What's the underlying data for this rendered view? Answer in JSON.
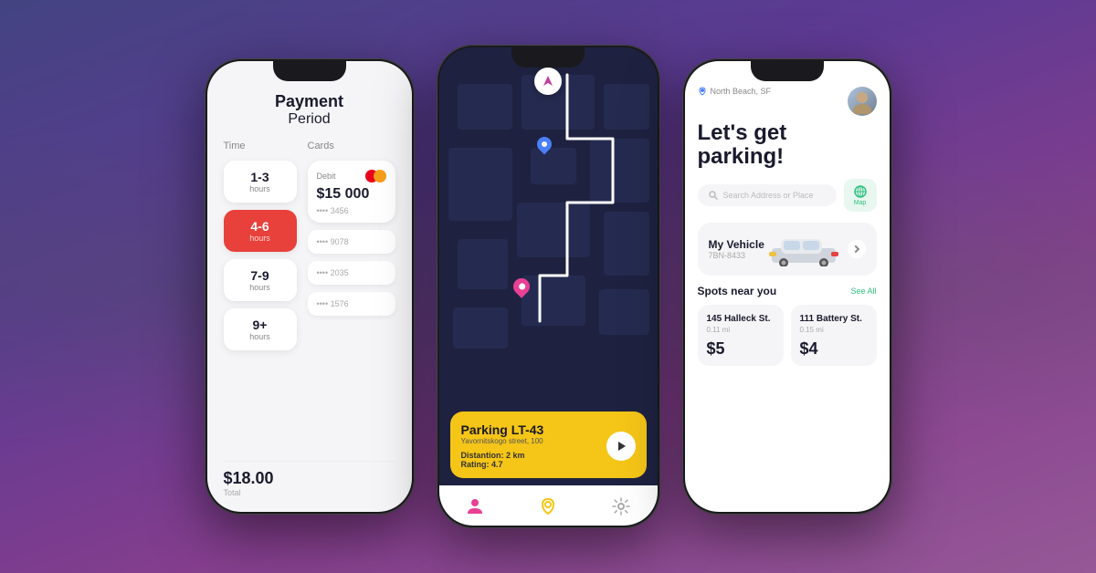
{
  "background": {
    "gradient_start": "#4a3aaa",
    "gradient_end": "#c040a0"
  },
  "phone1": {
    "title_line1": "Payment",
    "title_line2": "Period",
    "time_label": "Time",
    "cards_label": "Cards",
    "time_options": [
      {
        "range": "1-3",
        "unit": "hours",
        "active": false
      },
      {
        "range": "4-6",
        "unit": "hours",
        "active": true
      },
      {
        "range": "7-9",
        "unit": "hours",
        "active": false
      },
      {
        "range": "9+",
        "unit": "hours",
        "active": false
      }
    ],
    "main_card": {
      "type": "Debit",
      "amount": "$15 000",
      "number": "•••• 3456"
    },
    "mini_cards": [
      "•••• 9078",
      "•••• 2035",
      "•••• 1576"
    ],
    "total_amount": "$18.00",
    "total_label": "Total"
  },
  "phone2": {
    "parking_name": "Parking LT-43",
    "parking_address": "Yavornitskogo street, 100",
    "distance_label": "Distantion:",
    "distance_value": "2 km",
    "rating_label": "Rating:",
    "rating_value": "4.7",
    "nav_icons": [
      "person",
      "location",
      "settings"
    ]
  },
  "phone3": {
    "location": "North Beach, SF",
    "hero_title_line1": "Let's get",
    "hero_title_line2": "parking!",
    "search_placeholder": "Search Address or Place",
    "map_button_label": "Map",
    "vehicle_label": "My Vehicle",
    "vehicle_plate": "7BN-8433",
    "spots_title": "Spots near you",
    "see_all": "See All",
    "spots": [
      {
        "name": "145 Halleck St.",
        "distance": "0.11 mi",
        "price": "$5"
      },
      {
        "name": "111 Battery St.",
        "distance": "0.15 mi",
        "price": "$4"
      }
    ]
  }
}
